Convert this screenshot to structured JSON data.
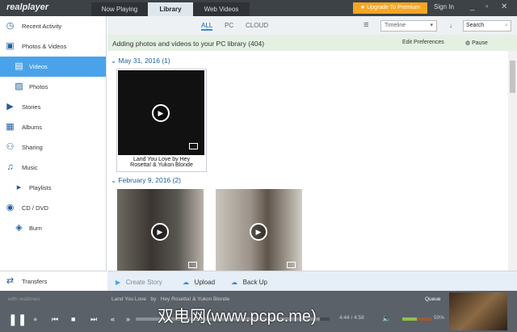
{
  "app": {
    "logo": "realplayer"
  },
  "tabs": [
    {
      "label": "Now Playing"
    },
    {
      "label": "Library",
      "active": true
    },
    {
      "label": "Web Videos"
    }
  ],
  "titlebar": {
    "upgrade": "Upgrade To Premium",
    "signin": "Sign In"
  },
  "sidebar": {
    "items": [
      {
        "label": "Recent Activity",
        "icon": "clock-icon"
      },
      {
        "label": "Photos & Videos",
        "icon": "photos-icon"
      },
      {
        "label": "Videos",
        "icon": "video-icon",
        "sub": true,
        "selected": true
      },
      {
        "label": "Photos",
        "icon": "photo-icon",
        "sub": true
      },
      {
        "label": "Stories",
        "icon": "stories-icon"
      },
      {
        "label": "Albums",
        "icon": "albums-icon"
      },
      {
        "label": "Sharing",
        "icon": "sharing-icon"
      },
      {
        "label": "Music",
        "icon": "music-icon"
      },
      {
        "label": "Playlists",
        "icon": "playlist-icon",
        "sub": true
      },
      {
        "label": "CD / DVD",
        "icon": "disc-icon"
      },
      {
        "label": "Burn",
        "icon": "burn-icon",
        "sub": true
      }
    ],
    "transfers": "Transfers"
  },
  "filters": {
    "all": "ALL",
    "pc": "PC",
    "cloud": "CLOUD",
    "sort": "Timeline",
    "search_placeholder": "Search"
  },
  "banner": {
    "text": "Adding photos and videos to your PC library (404)",
    "edit": "Edit Preferences",
    "pause": "Pause"
  },
  "sections": [
    {
      "date": "May 31, 2016 (1)",
      "items": [
        {
          "caption": "Land You Love   by   Hey Rosetta! & Yukon Blonde"
        }
      ]
    },
    {
      "date": "February 9, 2016 (2)",
      "items": [
        {
          "caption": ""
        },
        {
          "caption": ""
        }
      ]
    }
  ],
  "actions": {
    "create_story": "Create Story",
    "upload": "Upload",
    "backup": "Back Up"
  },
  "player": {
    "with": "with",
    "realtimes": "realtimes",
    "track": "Land You Love",
    "by": "by",
    "artist": "Hey Rosetta! & Yukon Blonde",
    "queue": "Queue",
    "time": "4:44 / 4:58",
    "volume": "50%",
    "progress": 0.95,
    "volume_level": 0.5
  },
  "watermark": "双电网(www.pcpc.me)"
}
